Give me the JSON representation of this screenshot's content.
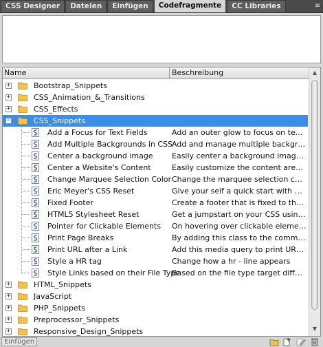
{
  "tabs": [
    {
      "label": "CSS Designer",
      "active": false
    },
    {
      "label": "Dateien",
      "active": false
    },
    {
      "label": "Einfügen",
      "active": false
    },
    {
      "label": "Codefragmente",
      "active": true
    },
    {
      "label": "CC Libraries",
      "active": false
    }
  ],
  "columns": {
    "name": "Name",
    "description": "Beschreibung"
  },
  "tree": [
    {
      "type": "folder",
      "name": "Bootstrap_Snippets",
      "expanded": false
    },
    {
      "type": "folder",
      "name": "CSS_Animation_&_Transitions",
      "expanded": false
    },
    {
      "type": "folder",
      "name": "CSS_Effects",
      "expanded": false
    },
    {
      "type": "folder",
      "name": "CSS_Snippets",
      "expanded": true,
      "selected": true
    },
    {
      "type": "snippet",
      "name": "Add a Focus for Text Fields",
      "desc": "Add an outer glow to focus on text fie..."
    },
    {
      "type": "snippet",
      "name": "Add Multiple Backgrounds in CSS",
      "desc": "Add and manage multiple background ..."
    },
    {
      "type": "snippet",
      "name": "Center a background image",
      "desc": "Easily center a background image for ..."
    },
    {
      "type": "snippet",
      "name": "Center a Website's Content",
      "desc": "Easily customize the content area and..."
    },
    {
      "type": "snippet",
      "name": "Change Marquee Selection Color",
      "desc": "Change the marquee selection color u..."
    },
    {
      "type": "snippet",
      "name": "Eric Meyer's CSS Reset",
      "desc": "Give your self a quick start with Eric M..."
    },
    {
      "type": "snippet",
      "name": "Fixed Footer",
      "desc": "Create a footer that is fixed to the bo..."
    },
    {
      "type": "snippet",
      "name": "HTML5 Stylesheet Reset",
      "desc": "Get a jumpstart on your CSS using thi..."
    },
    {
      "type": "snippet",
      "name": "Pointer for Clickable Elements",
      "desc": "On hovering over clickable elements, ..."
    },
    {
      "type": "snippet",
      "name": "Print Page Breaks",
      "desc": "By adding this class to the comments ..."
    },
    {
      "type": "snippet",
      "name": "Print URL after a Link",
      "desc": "Add this media query to print URL aft..."
    },
    {
      "type": "snippet",
      "name": "Style a HR tag",
      "desc": "Change how a hr - line appears"
    },
    {
      "type": "snippet",
      "name": "Style Links based on their File Type",
      "desc": "Based on the file type target different..."
    },
    {
      "type": "folder",
      "name": "HTML_Snippets",
      "expanded": false
    },
    {
      "type": "folder",
      "name": "JavaScript",
      "expanded": false
    },
    {
      "type": "folder",
      "name": "PHP_Snippets",
      "expanded": false
    },
    {
      "type": "folder",
      "name": "Preprocessor_Snippets",
      "expanded": false
    },
    {
      "type": "folder",
      "name": "Responsive_Design_Snippets",
      "expanded": false
    }
  ],
  "bottombar": {
    "insert_label": "Einfügen",
    "icons": [
      "new-folder-icon",
      "new-snippet-icon",
      "edit-snippet-icon",
      "delete-icon"
    ]
  },
  "colors": {
    "selection": "#3c8ee5",
    "folder": "#f2c14e",
    "snippet_icon": "#2e5fb0"
  }
}
